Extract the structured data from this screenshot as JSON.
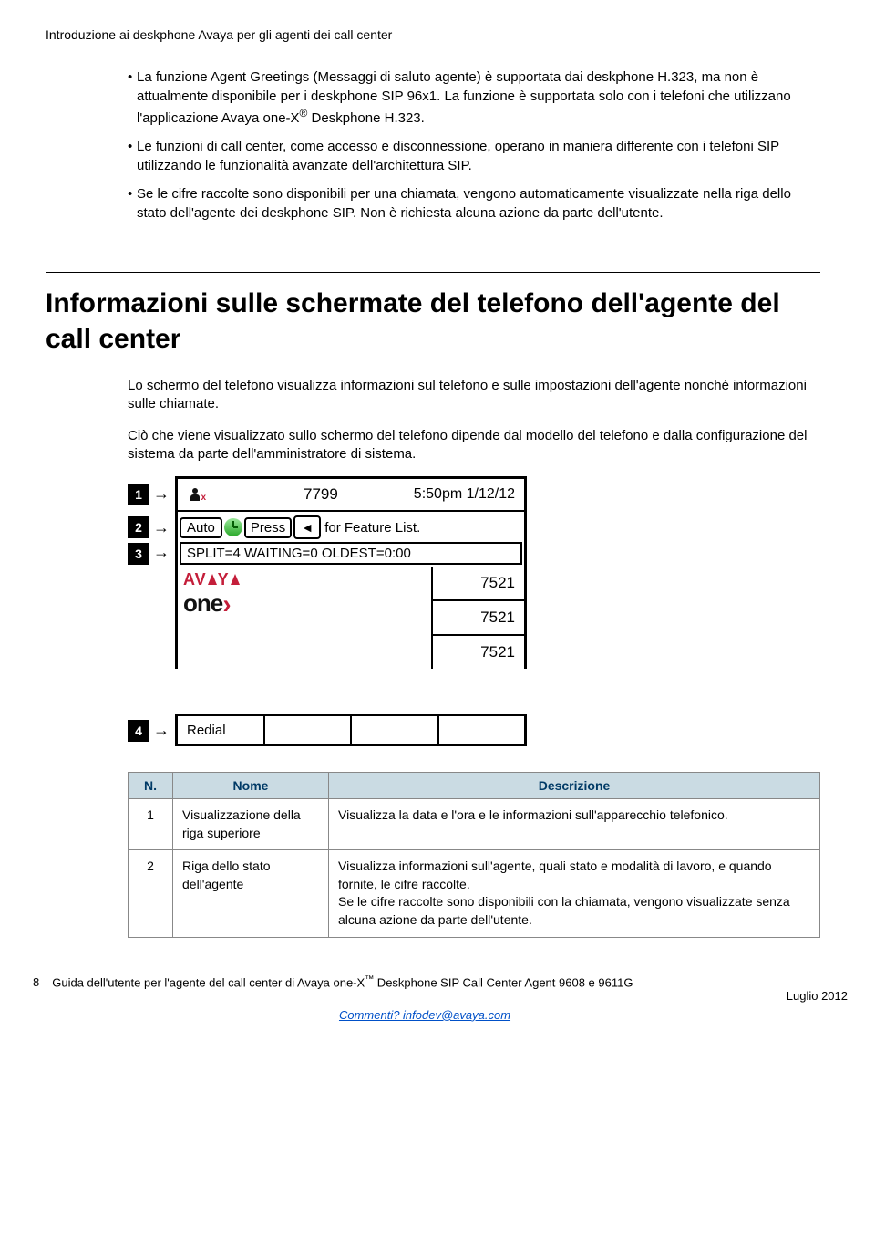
{
  "header": "Introduzione ai deskphone Avaya per gli agenti dei call center",
  "bullets": [
    "La funzione Agent Greetings (Messaggi di saluto agente) è supportata dai deskphone H.323, ma non è attualmente disponibile per i deskphone SIP 96x1. La funzione è supportata solo con i telefoni che utilizzano l'applicazione Avaya one-X® Deskphone H.323.",
    "Le funzioni di call center, come accesso e disconnessione, operano in maniera differente con i telefoni SIP utilizzando le funzionalità avanzate dell'architettura SIP.",
    "Se le cifre raccolte sono disponibili per una chiamata, vengono automaticamente visualizzate nella riga dello stato dell'agente dei deskphone SIP. Non è richiesta alcuna azione da parte dell'utente."
  ],
  "section_title": "Informazioni sulle schermate del telefono dell'agente del call center",
  "para1": "Lo schermo del telefono visualizza informazioni sul telefono e sulle impostazioni dell'agente nonché informazioni sulle chiamate.",
  "para2": "Ciò che viene visualizzato sullo schermo del telefono dipende dal modello del telefono e dalla configurazione del sistema da parte dell'amministratore di sistema.",
  "screen": {
    "ext": "7799",
    "datetime": "5:50pm 1/12/12",
    "mode": "Auto",
    "hint_a": "Press",
    "hint_b": "for Feature List.",
    "queue": "SPLIT=4  WAITING=0   OLDEST=0:00",
    "line": "7521",
    "soft1": "Redial"
  },
  "table": {
    "h1": "N.",
    "h2": "Nome",
    "h3": "Descrizione",
    "rows": [
      {
        "n": "1",
        "nome": "Visualizzazione della riga superiore",
        "desc": "Visualizza la data e l'ora e le informazioni sull'apparecchio telefonico."
      },
      {
        "n": "2",
        "nome": "Riga dello stato dell'agente",
        "desc": "Visualizza informazioni sull'agente, quali stato e modalità di lavoro, e quando fornite, le cifre raccolte.\nSe le cifre raccolte sono disponibili con la chiamata, vengono visualizzate senza alcuna azione da parte dell'utente."
      }
    ]
  },
  "footer": {
    "page": "8",
    "title": "Guida dell'utente per l'agente del call center di Avaya one-X™ Deskphone SIP Call Center Agent 9608 e 9611G",
    "date": "Luglio 2012",
    "link_text": "Commenti? infodev@avaya.com"
  }
}
